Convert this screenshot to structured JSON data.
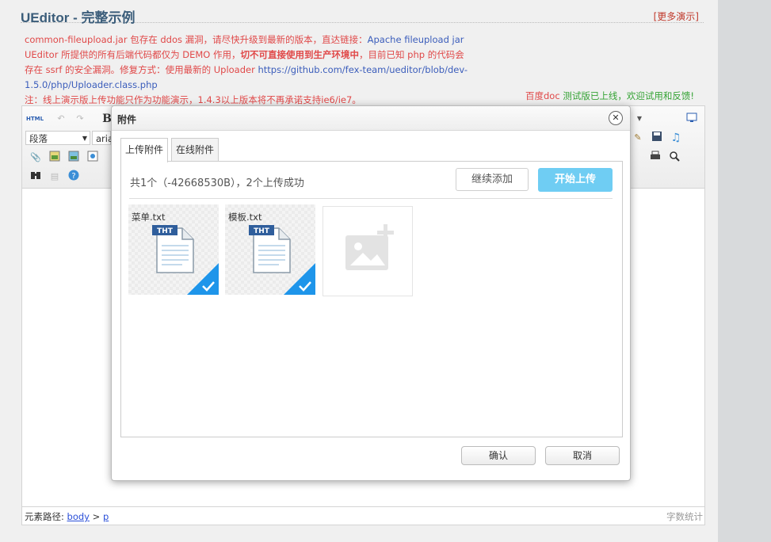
{
  "header": {
    "title": "UEditor - 完整示例",
    "more_link": "[更多演示]"
  },
  "notice": {
    "line1_text": "common-fileupload.jar 包存在 ddos 漏洞，请尽快升级到最新的版本，直达链接：",
    "line1_link": "Apache fileupload jar",
    "line2_pre": "UEditor 所提供的所有后端代码都仅为 DEMO 作用，",
    "line2_bold": "切不可直接使用到生产环境中",
    "line2_post": "，目前已知 php 的代码会存在 ssrf 的安全漏洞。修复方式：使用最新的 Uploader ",
    "line2_link": "https://github.com/fex-team/ueditor/blob/dev-1.5.0/php/Uploader.class.php",
    "line3": "注：线上演示版上传功能只作为功能演示，1.4.3以上版本将不再承诺支持ie6/ie7。",
    "right_pre": "百度doc",
    "right_post": " 测试版已上线，欢迎试用和反馈!"
  },
  "toolbar": {
    "source_label": "HTML",
    "paragraph_select": "段落",
    "font_select": "aria",
    "bold_label": "B"
  },
  "statusbar": {
    "path_label": "元素路径: ",
    "path_body": "body",
    "path_sep": " > ",
    "path_p": "p",
    "word_count": "字数统计"
  },
  "dialog": {
    "title": "附件",
    "close_glyph": "✕",
    "tabs": [
      {
        "label": "上传附件",
        "active": true
      },
      {
        "label": "在线附件",
        "active": false
      }
    ],
    "status_text": "共1个（-42668530B），2个上传成功",
    "add_button": "继续添加",
    "upload_button": "开始上传",
    "files": [
      {
        "name": "菜单.txt",
        "badge": "THT",
        "uploaded": true
      },
      {
        "name": "模板.txt",
        "badge": "THT",
        "uploaded": true
      }
    ],
    "confirm_button": "确认",
    "cancel_button": "取消"
  },
  "colors": {
    "accent_blue": "#1e95ea",
    "upload_button": "#6fcdf3",
    "notice_red": "#e04848",
    "notice_green": "#35a335",
    "title_blue": "#3b5d7a"
  }
}
